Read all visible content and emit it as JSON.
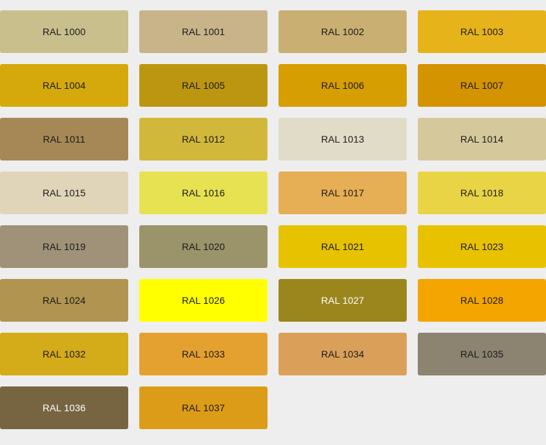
{
  "swatches": [
    {
      "label": "RAL 1000",
      "color": "#c8bf8c",
      "text_color": "#1a1a1a"
    },
    {
      "label": "RAL 1001",
      "color": "#c9b48a",
      "text_color": "#1a1a1a"
    },
    {
      "label": "RAL 1002",
      "color": "#c9b072",
      "text_color": "#1a1a1a"
    },
    {
      "label": "RAL 1003",
      "color": "#e6b31b",
      "text_color": "#1a1a1a"
    },
    {
      "label": "RAL 1004",
      "color": "#d5a90b",
      "text_color": "#1a1a1a"
    },
    {
      "label": "RAL 1005",
      "color": "#bc9611",
      "text_color": "#1a1a1a"
    },
    {
      "label": "RAL 1006",
      "color": "#d69e01",
      "text_color": "#1a1a1a"
    },
    {
      "label": "RAL 1007",
      "color": "#d49300",
      "text_color": "#1a1a1a"
    },
    {
      "label": "RAL 1011",
      "color": "#a68856",
      "text_color": "#1a1a1a"
    },
    {
      "label": "RAL 1012",
      "color": "#d1b83b",
      "text_color": "#1a1a1a"
    },
    {
      "label": "RAL 1013",
      "color": "#e1dcc8",
      "text_color": "#1a1a1a"
    },
    {
      "label": "RAL 1014",
      "color": "#d5c99c",
      "text_color": "#1a1a1a"
    },
    {
      "label": "RAL 1015",
      "color": "#e0d5b9",
      "text_color": "#1a1a1a"
    },
    {
      "label": "RAL 1016",
      "color": "#e6e251",
      "text_color": "#1a1a1a"
    },
    {
      "label": "RAL 1017",
      "color": "#e6ae55",
      "text_color": "#1a1a1a"
    },
    {
      "label": "RAL 1018",
      "color": "#e8d445",
      "text_color": "#1a1a1a"
    },
    {
      "label": "RAL 1019",
      "color": "#9f9279",
      "text_color": "#1a1a1a"
    },
    {
      "label": "RAL 1020",
      "color": "#9b936a",
      "text_color": "#1a1a1a"
    },
    {
      "label": "RAL 1021",
      "color": "#e6c200",
      "text_color": "#1a1a1a"
    },
    {
      "label": "RAL 1023",
      "color": "#e8c200",
      "text_color": "#1a1a1a"
    },
    {
      "label": "RAL 1024",
      "color": "#b09450",
      "text_color": "#1a1a1a"
    },
    {
      "label": "RAL 1026",
      "color": "#ffff00",
      "text_color": "#1a1a1a"
    },
    {
      "label": "RAL 1027",
      "color": "#9b861e",
      "text_color": "#ffffff"
    },
    {
      "label": "RAL 1028",
      "color": "#f4a500",
      "text_color": "#1a1a1a"
    },
    {
      "label": "RAL 1032",
      "color": "#d4ab18",
      "text_color": "#1a1a1a"
    },
    {
      "label": "RAL 1033",
      "color": "#e5a130",
      "text_color": "#1a1a1a"
    },
    {
      "label": "RAL 1034",
      "color": "#daa059",
      "text_color": "#1a1a1a"
    },
    {
      "label": "RAL 1035",
      "color": "#8c8371",
      "text_color": "#1a1a1a"
    },
    {
      "label": "RAL 1036",
      "color": "#776542",
      "text_color": "#ffffff"
    },
    {
      "label": "RAL 1037",
      "color": "#dd9c18",
      "text_color": "#1a1a1a"
    }
  ]
}
